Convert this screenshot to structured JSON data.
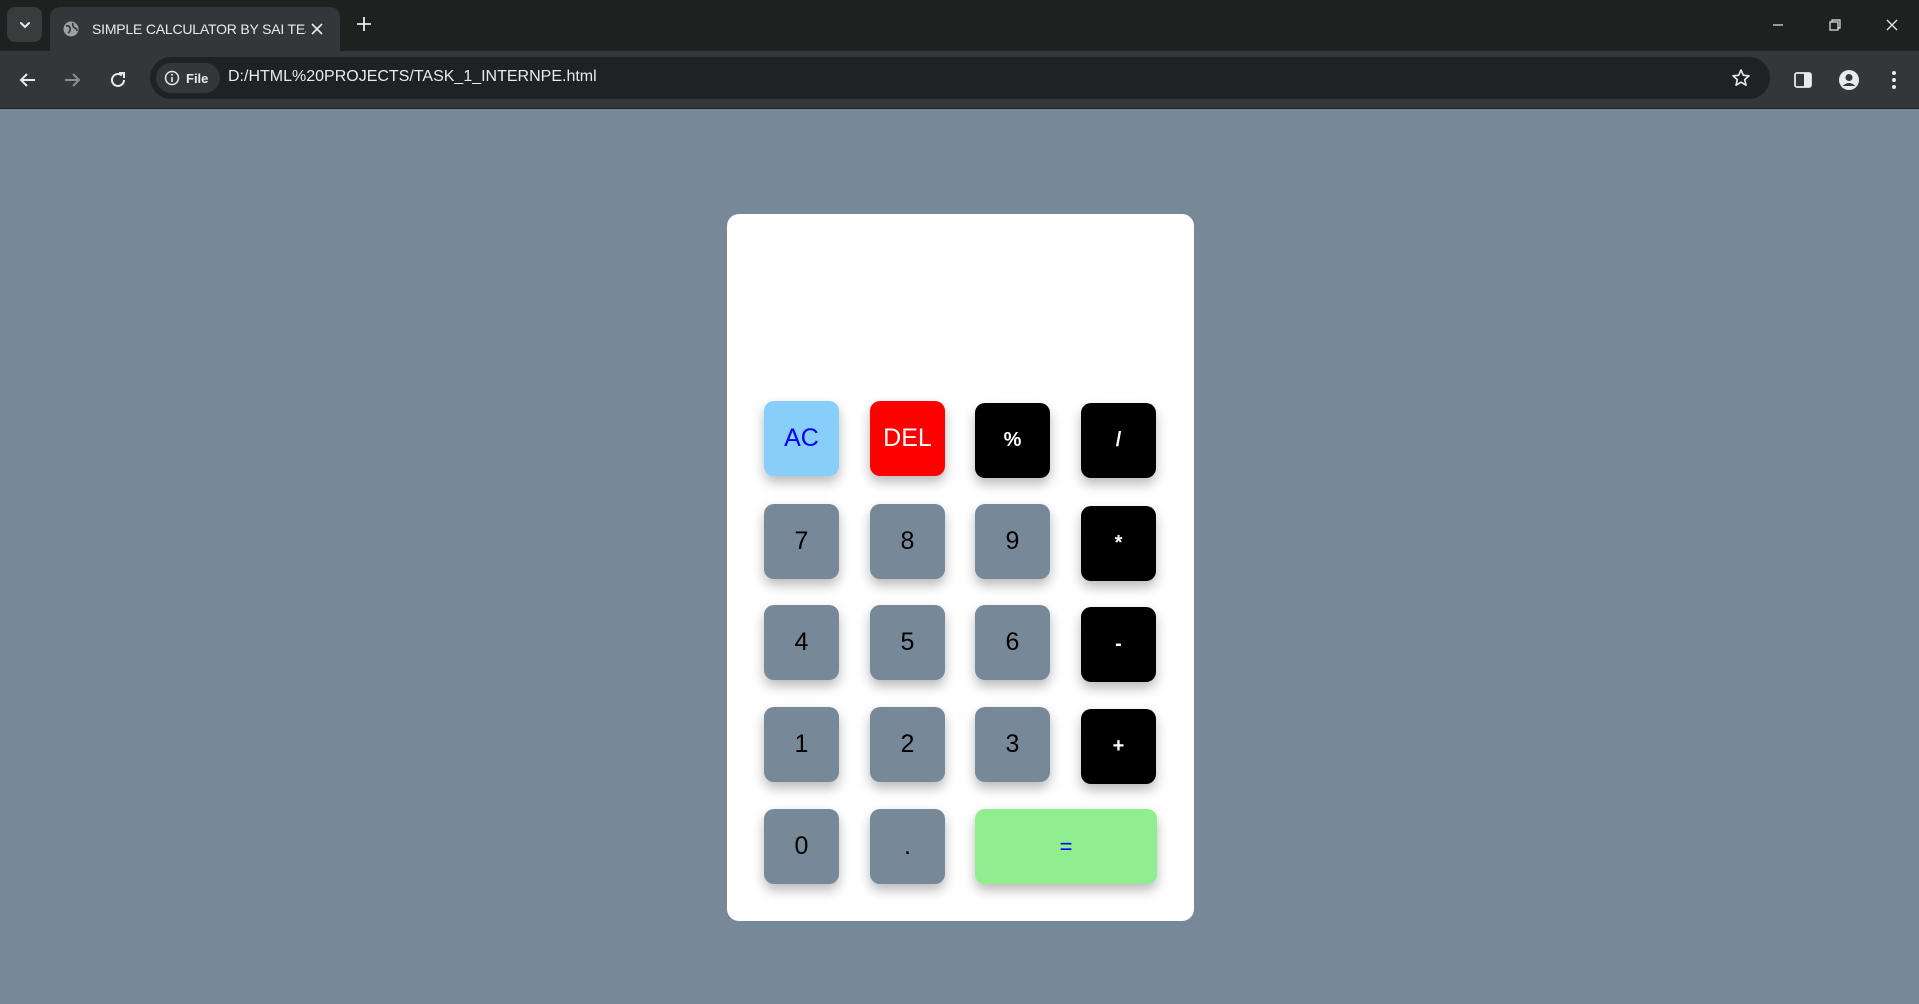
{
  "browser": {
    "tab_title": "SIMPLE CALCULATOR BY SAI TEJA",
    "site_chip_label": "File",
    "url": "D:/HTML%20PROJECTS/TASK_1_INTERNPE.html"
  },
  "calculator": {
    "display_value": "",
    "keys": {
      "ac": "AC",
      "del": "DEL",
      "percent": "%",
      "divide": "/",
      "seven": "7",
      "eight": "8",
      "nine": "9",
      "multiply": "*",
      "four": "4",
      "five": "5",
      "six": "6",
      "minus": "-",
      "one": "1",
      "two": "2",
      "three": "3",
      "plus": "+",
      "zero": "0",
      "dot": ".",
      "equals": "="
    },
    "colors": {
      "page_background": "#778899",
      "number_key": "#778899",
      "operator_key": "#000000",
      "ac_key": "#87cefa",
      "del_key": "#ff0000",
      "equals_key": "#90ee90"
    }
  }
}
